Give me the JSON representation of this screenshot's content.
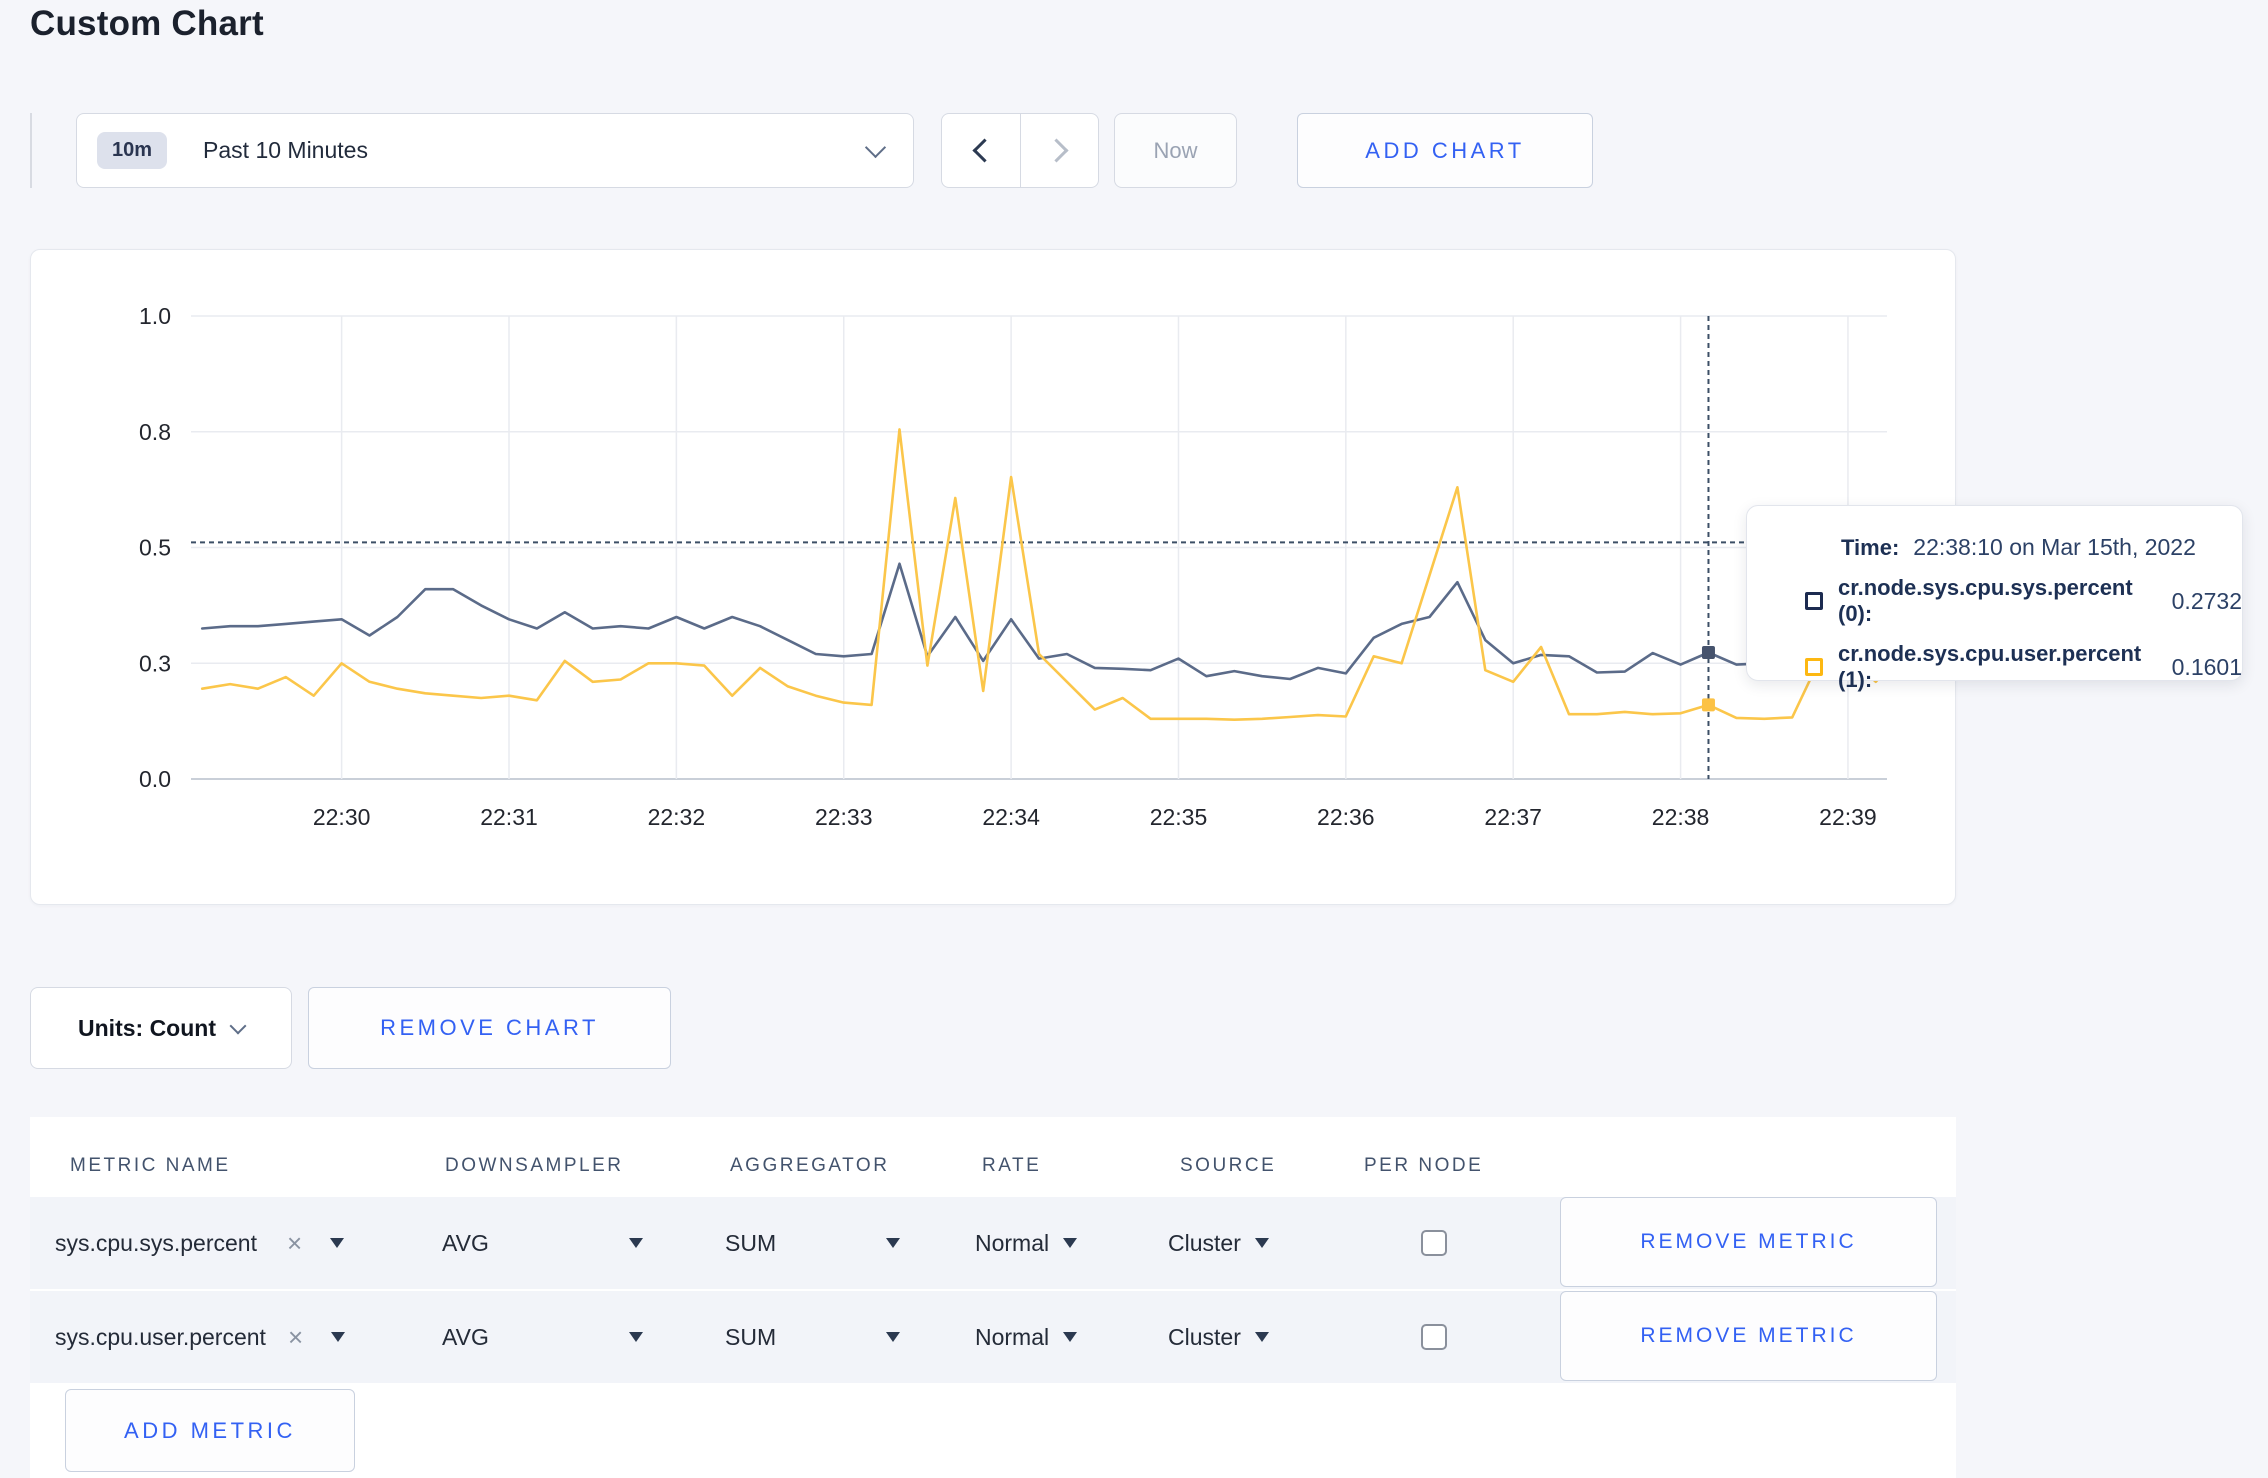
{
  "page": {
    "title": "Custom Chart"
  },
  "toolbar": {
    "time_badge": "10m",
    "time_label": "Past 10 Minutes",
    "now_label": "Now",
    "add_chart_label": "ADD CHART"
  },
  "chart_footer": {
    "units_label": "Units: Count",
    "remove_chart_label": "REMOVE CHART"
  },
  "chart_data": {
    "type": "line",
    "title": "",
    "xlabel": "",
    "ylabel": "",
    "grid": true,
    "legend_position": "tooltip",
    "ylim": [
      0,
      1
    ],
    "y_tick_values": [
      0,
      0.25,
      0.5,
      0.75,
      1.0
    ],
    "y_tick_labels": [
      "0.0",
      "0.3",
      "0.5",
      "0.8",
      "1.0"
    ],
    "x_ticks": [
      "22:30",
      "22:31",
      "22:32",
      "22:33",
      "22:34",
      "22:35",
      "22:36",
      "22:37",
      "22:38",
      "22:39"
    ],
    "x_domain": [
      "22:29:06",
      "22:39:14"
    ],
    "sample_start": "22:29:10",
    "sample_interval_seconds": 10,
    "series": [
      {
        "name": "cr.node.sys.cpu.sys.percent (0)",
        "color": "#5b6b89",
        "values": [
          0.325,
          0.33,
          0.33,
          0.335,
          0.34,
          0.345,
          0.31,
          0.35,
          0.41,
          0.41,
          0.375,
          0.345,
          0.325,
          0.36,
          0.325,
          0.33,
          0.325,
          0.35,
          0.325,
          0.35,
          0.33,
          0.3,
          0.27,
          0.265,
          0.27,
          0.465,
          0.265,
          0.35,
          0.255,
          0.345,
          0.26,
          0.27,
          0.24,
          0.238,
          0.235,
          0.26,
          0.222,
          0.233,
          0.222,
          0.216,
          0.24,
          0.228,
          0.305,
          0.335,
          0.35,
          0.425,
          0.3,
          0.25,
          0.268,
          0.265,
          0.23,
          0.232,
          0.272,
          0.247,
          0.2732,
          0.247,
          0.25,
          0.26,
          0.295,
          0.3,
          0.29,
          0.28
        ]
      },
      {
        "name": "cr.node.sys.cpu.user.percent (1)",
        "color": "#fbc64a",
        "values": [
          0.195,
          0.205,
          0.195,
          0.22,
          0.18,
          0.25,
          0.21,
          0.195,
          0.185,
          0.18,
          0.175,
          0.18,
          0.17,
          0.255,
          0.21,
          0.215,
          0.25,
          0.25,
          0.245,
          0.18,
          0.24,
          0.2,
          0.18,
          0.165,
          0.16,
          0.755,
          0.245,
          0.607,
          0.19,
          0.652,
          0.27,
          0.21,
          0.15,
          0.175,
          0.13,
          0.13,
          0.13,
          0.128,
          0.13,
          0.134,
          0.138,
          0.135,
          0.265,
          0.25,
          0.44,
          0.63,
          0.235,
          0.21,
          0.285,
          0.14,
          0.14,
          0.145,
          0.14,
          0.142,
          0.1601,
          0.132,
          0.13,
          0.133,
          0.26,
          0.265,
          0.21,
          0.28
        ]
      }
    ],
    "crosshair": {
      "time": "22:38:10",
      "hover_value": 0.511,
      "dot_values": [
        0.2732,
        0.1601
      ]
    }
  },
  "tooltip": {
    "time_label": "Time:",
    "time_value": "22:38:10 on Mar 15th, 2022",
    "rows": [
      {
        "name": "cr.node.sys.cpu.sys.percent (0):",
        "value": "0.2732",
        "swatch": "#1c2b50"
      },
      {
        "name": "cr.node.sys.cpu.user.percent (1):",
        "value": "0.1601",
        "swatch": "#fdb812"
      }
    ]
  },
  "metrics_table": {
    "headers": [
      "METRIC NAME",
      "DOWNSAMPLER",
      "AGGREGATOR",
      "RATE",
      "SOURCE",
      "PER NODE"
    ],
    "clear_icon": "×",
    "rows": [
      {
        "metric": "sys.cpu.sys.percent",
        "downsampler": "AVG",
        "aggregator": "SUM",
        "rate": "Normal",
        "source": "Cluster",
        "per_node_checked": false,
        "remove_label": "REMOVE METRIC"
      },
      {
        "metric": "sys.cpu.user.percent",
        "downsampler": "AVG",
        "aggregator": "SUM",
        "rate": "Normal",
        "source": "Cluster",
        "per_node_checked": false,
        "remove_label": "REMOVE METRIC"
      }
    ],
    "add_metric_label": "ADD METRIC"
  }
}
